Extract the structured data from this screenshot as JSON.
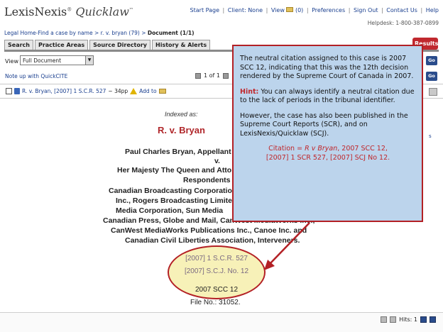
{
  "header": {
    "logo_text": "LexisNexis",
    "logo_reg": "®",
    "logo_product": "Quicklaw",
    "logo_tm": "™",
    "top_links": {
      "start_page": "Start Page",
      "client_label": "Client: None",
      "view": "View",
      "view_count": "(0)",
      "preferences": "Preferences",
      "sign_out": "Sign Out",
      "contact_us": "Contact Us",
      "help": "Help"
    },
    "helpdesk": "Helpdesk: 1-800-387-0899"
  },
  "breadcrumb": {
    "legal_home": "Legal Home",
    "find_case": "-Find a case by name",
    "query": " > r. v. bryan (79) > ",
    "current": "Document (1/1)"
  },
  "tabs": [
    {
      "label": "Search"
    },
    {
      "label": "Practice Areas"
    },
    {
      "label": "Source Directory"
    },
    {
      "label": "History & Alerts"
    }
  ],
  "results_button": "Results",
  "view_bar": {
    "label": "View",
    "selected": "Full Document"
  },
  "noteup_link": "Note up with QuickCITE",
  "pager": {
    "text": "1 of 1"
  },
  "go_label": "Go",
  "result_row": {
    "case": "R. v. Bryan, [2007] 1 S.C.R. 527",
    "pages": "~ 34pp",
    "add_to": "Add to"
  },
  "side_letter": "s",
  "document": {
    "indexed_as": "Indexed as:",
    "title": "R. v. Bryan",
    "parties": [
      "Paul Charles Bryan, Appellant",
      "v.",
      "Her Majesty The Queen and Attorney General",
      "Respondents",
      "Canadian Broadcasting Corporation,",
      "Inc., Rogers Broadcasting Limited",
      "Media Corporation, Sun Media",
      "Canadian Press, Globe and Mail, CanWest MediaWorks Inc.,",
      "CanWest MediaWorks Publications Inc., Canoe Inc. and",
      "Canadian Civil Liberties Association, Interveners."
    ],
    "citations": [
      "[2007] 1 S.C.R. 527",
      "[2007] S.C.J. No. 12",
      "2007 SCC 12"
    ],
    "file_no": "File No.: 31052."
  },
  "callout": {
    "para1": "The neutral citation assigned to this case is 2007 SCC 12, indicating that this was the 12th decision rendered by the Supreme Court of Canada in 2007.",
    "hint_label": "Hint:",
    "hint_text": "  You can always identify a neutral citation due to the lack of periods in the tribunal identifier.",
    "para3": "However, the case has also been published in the Supreme Court Reports (SCR), and on LexisNexis/Quicklaw (SCJ).",
    "citation_prefix": "Citation = ",
    "citation_case": "R v Bryan",
    "citation_line1_rest": ", 2007 SCC 12,",
    "citation_line2": "[2007] 1 SCR 527, [2007] SCJ No 12."
  },
  "bottom": {
    "hits_label": "Hits: 1"
  },
  "colors": {
    "callout_bg": "#bcd4ec",
    "callout_border": "#b32025",
    "title_red": "#b0262a",
    "link_blue": "#1a3f8f",
    "ellipse_fill": "#f7f1b8"
  }
}
